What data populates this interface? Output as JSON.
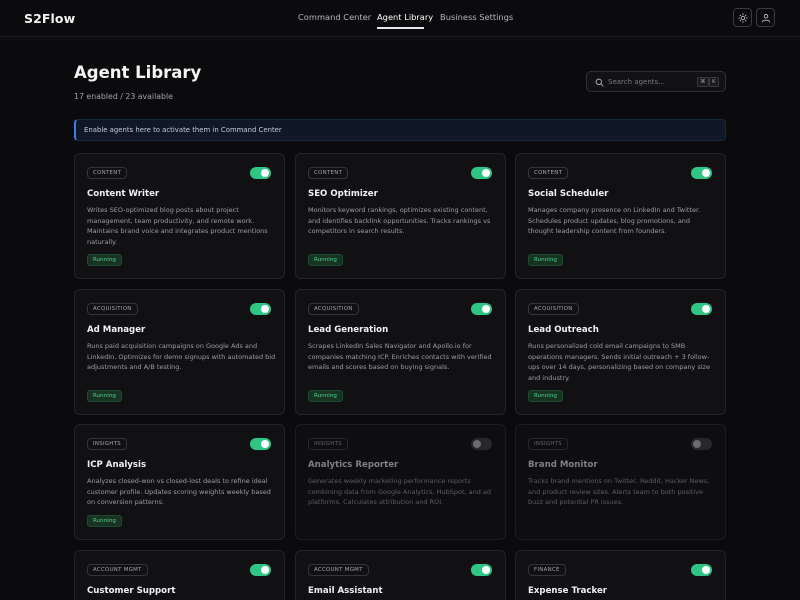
{
  "app": {
    "name": "S2Flow"
  },
  "nav": {
    "items": [
      {
        "label": "Command Center",
        "active": false
      },
      {
        "label": "Agent Library",
        "active": true
      },
      {
        "label": "Business Settings",
        "active": false
      }
    ],
    "theme_icon": "sun-icon",
    "user_icon": "user-icon"
  },
  "header": {
    "title": "Agent Library",
    "subtitle": "17 enabled / 23 available"
  },
  "search": {
    "placeholder": "Search agents...",
    "shortcut_keys": [
      "⌘",
      "K"
    ]
  },
  "banner": {
    "text": "Enable agents here to activate them in Command Center",
    "accent_color": "#3f7ce8"
  },
  "colors": {
    "toggle_on": "#2fc685",
    "status_running": "#4ed38c"
  },
  "agents": [
    {
      "category": "CONTENT",
      "name": "Content Writer",
      "enabled": true,
      "status": "Running",
      "description": "Writes SEO-optimized blog posts about project management, team productivity, and remote work. Maintains brand voice and integrates product mentions naturally."
    },
    {
      "category": "CONTENT",
      "name": "SEO Optimizer",
      "enabled": true,
      "status": "Running",
      "description": "Monitors keyword rankings, optimizes existing content, and identifies backlink opportunities. Tracks rankings vs competitors in search results."
    },
    {
      "category": "CONTENT",
      "name": "Social Scheduler",
      "enabled": true,
      "status": "Running",
      "description": "Manages company presence on LinkedIn and Twitter. Schedules product updates, blog promotions, and thought leadership content from founders."
    },
    {
      "category": "ACQUISITION",
      "name": "Ad Manager",
      "enabled": true,
      "status": "Running",
      "description": "Runs paid acquisition campaigns on Google Ads and LinkedIn. Optimizes for demo signups with automated bid adjustments and A/B testing."
    },
    {
      "category": "ACQUISITION",
      "name": "Lead Generation",
      "enabled": true,
      "status": "Running",
      "description": "Scrapes LinkedIn Sales Navigator and Apollo.io for companies matching ICP. Enriches contacts with verified emails and scores based on buying signals."
    },
    {
      "category": "ACQUISITION",
      "name": "Lead Outreach",
      "enabled": true,
      "status": "Running",
      "description": "Runs personalized cold email campaigns to SMB operations managers. Sends initial outreach + 3 follow-ups over 14 days, personalizing based on company size and industry."
    },
    {
      "category": "INSIGHTS",
      "name": "ICP Analysis",
      "enabled": true,
      "status": "Running",
      "description": "Analyzes closed-won vs closed-lost deals to refine ideal customer profile. Updates scoring weights weekly based on conversion patterns."
    },
    {
      "category": "INSIGHTS",
      "name": "Analytics Reporter",
      "enabled": false,
      "status": "",
      "description": "Generates weekly marketing performance reports combining data from Google Analytics, HubSpot, and ad platforms. Calculates attribution and ROI."
    },
    {
      "category": "INSIGHTS",
      "name": "Brand Monitor",
      "enabled": false,
      "status": "",
      "description": "Tracks brand mentions on Twitter, Reddit, Hacker News, and product review sites. Alerts team to both positive buzz and potential PR issues."
    },
    {
      "category": "ACCOUNT MGMT",
      "name": "Customer Support",
      "enabled": true,
      "status": "",
      "description": ""
    },
    {
      "category": "ACCOUNT MGMT",
      "name": "Email Assistant",
      "enabled": true,
      "status": "",
      "description": ""
    },
    {
      "category": "FINANCE",
      "name": "Expense Tracker",
      "enabled": true,
      "status": "",
      "description": ""
    }
  ]
}
